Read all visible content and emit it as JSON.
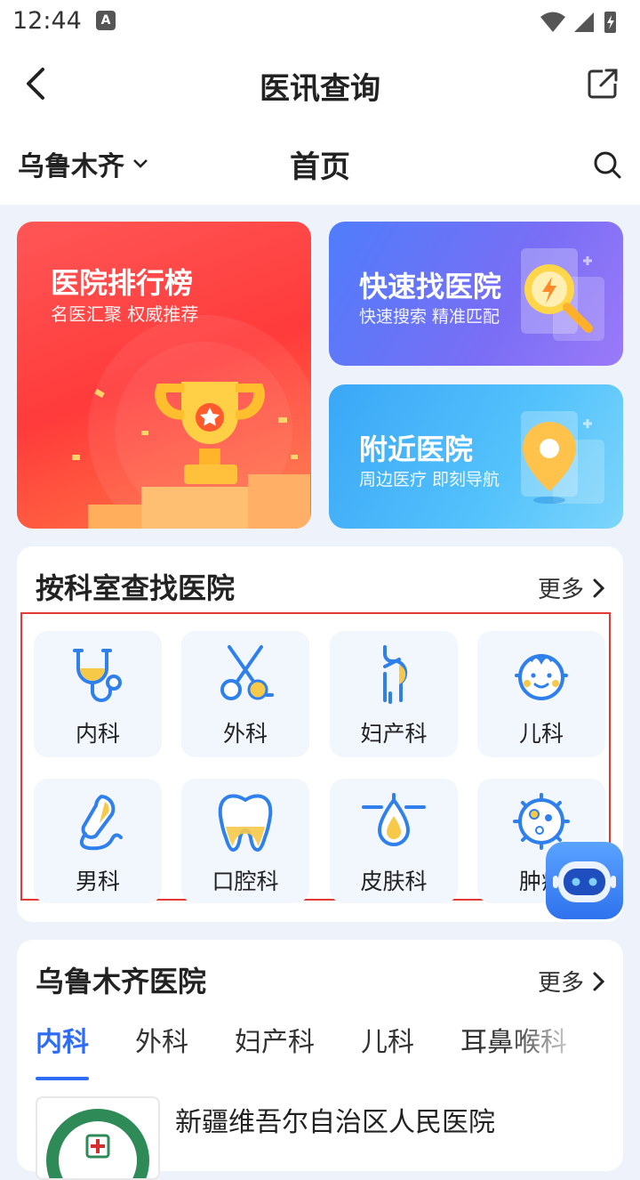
{
  "status": {
    "time": "12:44",
    "notif_letter": "A"
  },
  "nav": {
    "title": "医讯查询"
  },
  "subbar": {
    "city": "乌鲁木齐",
    "title": "首页"
  },
  "cards": {
    "rank": {
      "title": "医院排行榜",
      "sub": "名医汇聚 权威推荐"
    },
    "fast": {
      "title": "快速找医院",
      "sub": "快速搜索 精准匹配"
    },
    "near": {
      "title": "附近医院",
      "sub": "周边医疗 即刻导航"
    }
  },
  "dept_section": {
    "title": "按科室查找医院",
    "more": "更多",
    "items": [
      {
        "label": "内科",
        "icon": "stethoscope-icon"
      },
      {
        "label": "外科",
        "icon": "scissors-icon"
      },
      {
        "label": "妇产科",
        "icon": "pregnant-icon"
      },
      {
        "label": "儿科",
        "icon": "baby-icon"
      },
      {
        "label": "男科",
        "icon": "male-icon"
      },
      {
        "label": "口腔科",
        "icon": "tooth-icon"
      },
      {
        "label": "皮肤科",
        "icon": "skin-icon"
      },
      {
        "label": "肿瘤",
        "icon": "tumor-icon"
      }
    ]
  },
  "city_section": {
    "title": "乌鲁木齐医院",
    "more": "更多",
    "tabs": [
      "内科",
      "外科",
      "妇产科",
      "儿科",
      "耳鼻喉科"
    ],
    "active_tab": 0,
    "hospital": {
      "name": "新疆维吾尔自治区人民医院",
      "logo_text": "新疆维吾尔自治区人民医院"
    }
  },
  "colors": {
    "accent": "#2f6cf6",
    "rank_red": "#ff4545",
    "icon_blue": "#2f80ed",
    "icon_yellow": "#f7c948"
  }
}
